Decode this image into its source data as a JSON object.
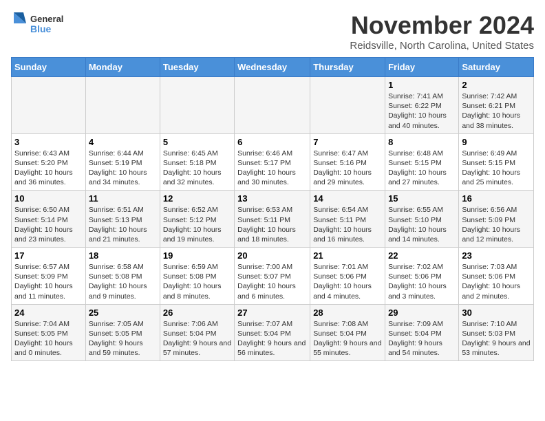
{
  "logo": {
    "text_general": "General",
    "text_blue": "Blue"
  },
  "header": {
    "month_title": "November 2024",
    "location": "Reidsville, North Carolina, United States"
  },
  "weekdays": [
    "Sunday",
    "Monday",
    "Tuesday",
    "Wednesday",
    "Thursday",
    "Friday",
    "Saturday"
  ],
  "weeks": [
    [
      {
        "day": "",
        "info": ""
      },
      {
        "day": "",
        "info": ""
      },
      {
        "day": "",
        "info": ""
      },
      {
        "day": "",
        "info": ""
      },
      {
        "day": "",
        "info": ""
      },
      {
        "day": "1",
        "info": "Sunrise: 7:41 AM\nSunset: 6:22 PM\nDaylight: 10 hours and 40 minutes."
      },
      {
        "day": "2",
        "info": "Sunrise: 7:42 AM\nSunset: 6:21 PM\nDaylight: 10 hours and 38 minutes."
      }
    ],
    [
      {
        "day": "3",
        "info": "Sunrise: 6:43 AM\nSunset: 5:20 PM\nDaylight: 10 hours and 36 minutes."
      },
      {
        "day": "4",
        "info": "Sunrise: 6:44 AM\nSunset: 5:19 PM\nDaylight: 10 hours and 34 minutes."
      },
      {
        "day": "5",
        "info": "Sunrise: 6:45 AM\nSunset: 5:18 PM\nDaylight: 10 hours and 32 minutes."
      },
      {
        "day": "6",
        "info": "Sunrise: 6:46 AM\nSunset: 5:17 PM\nDaylight: 10 hours and 30 minutes."
      },
      {
        "day": "7",
        "info": "Sunrise: 6:47 AM\nSunset: 5:16 PM\nDaylight: 10 hours and 29 minutes."
      },
      {
        "day": "8",
        "info": "Sunrise: 6:48 AM\nSunset: 5:15 PM\nDaylight: 10 hours and 27 minutes."
      },
      {
        "day": "9",
        "info": "Sunrise: 6:49 AM\nSunset: 5:15 PM\nDaylight: 10 hours and 25 minutes."
      }
    ],
    [
      {
        "day": "10",
        "info": "Sunrise: 6:50 AM\nSunset: 5:14 PM\nDaylight: 10 hours and 23 minutes."
      },
      {
        "day": "11",
        "info": "Sunrise: 6:51 AM\nSunset: 5:13 PM\nDaylight: 10 hours and 21 minutes."
      },
      {
        "day": "12",
        "info": "Sunrise: 6:52 AM\nSunset: 5:12 PM\nDaylight: 10 hours and 19 minutes."
      },
      {
        "day": "13",
        "info": "Sunrise: 6:53 AM\nSunset: 5:11 PM\nDaylight: 10 hours and 18 minutes."
      },
      {
        "day": "14",
        "info": "Sunrise: 6:54 AM\nSunset: 5:11 PM\nDaylight: 10 hours and 16 minutes."
      },
      {
        "day": "15",
        "info": "Sunrise: 6:55 AM\nSunset: 5:10 PM\nDaylight: 10 hours and 14 minutes."
      },
      {
        "day": "16",
        "info": "Sunrise: 6:56 AM\nSunset: 5:09 PM\nDaylight: 10 hours and 12 minutes."
      }
    ],
    [
      {
        "day": "17",
        "info": "Sunrise: 6:57 AM\nSunset: 5:09 PM\nDaylight: 10 hours and 11 minutes."
      },
      {
        "day": "18",
        "info": "Sunrise: 6:58 AM\nSunset: 5:08 PM\nDaylight: 10 hours and 9 minutes."
      },
      {
        "day": "19",
        "info": "Sunrise: 6:59 AM\nSunset: 5:08 PM\nDaylight: 10 hours and 8 minutes."
      },
      {
        "day": "20",
        "info": "Sunrise: 7:00 AM\nSunset: 5:07 PM\nDaylight: 10 hours and 6 minutes."
      },
      {
        "day": "21",
        "info": "Sunrise: 7:01 AM\nSunset: 5:06 PM\nDaylight: 10 hours and 4 minutes."
      },
      {
        "day": "22",
        "info": "Sunrise: 7:02 AM\nSunset: 5:06 PM\nDaylight: 10 hours and 3 minutes."
      },
      {
        "day": "23",
        "info": "Sunrise: 7:03 AM\nSunset: 5:06 PM\nDaylight: 10 hours and 2 minutes."
      }
    ],
    [
      {
        "day": "24",
        "info": "Sunrise: 7:04 AM\nSunset: 5:05 PM\nDaylight: 10 hours and 0 minutes."
      },
      {
        "day": "25",
        "info": "Sunrise: 7:05 AM\nSunset: 5:05 PM\nDaylight: 9 hours and 59 minutes."
      },
      {
        "day": "26",
        "info": "Sunrise: 7:06 AM\nSunset: 5:04 PM\nDaylight: 9 hours and 57 minutes."
      },
      {
        "day": "27",
        "info": "Sunrise: 7:07 AM\nSunset: 5:04 PM\nDaylight: 9 hours and 56 minutes."
      },
      {
        "day": "28",
        "info": "Sunrise: 7:08 AM\nSunset: 5:04 PM\nDaylight: 9 hours and 55 minutes."
      },
      {
        "day": "29",
        "info": "Sunrise: 7:09 AM\nSunset: 5:04 PM\nDaylight: 9 hours and 54 minutes."
      },
      {
        "day": "30",
        "info": "Sunrise: 7:10 AM\nSunset: 5:03 PM\nDaylight: 9 hours and 53 minutes."
      }
    ]
  ]
}
